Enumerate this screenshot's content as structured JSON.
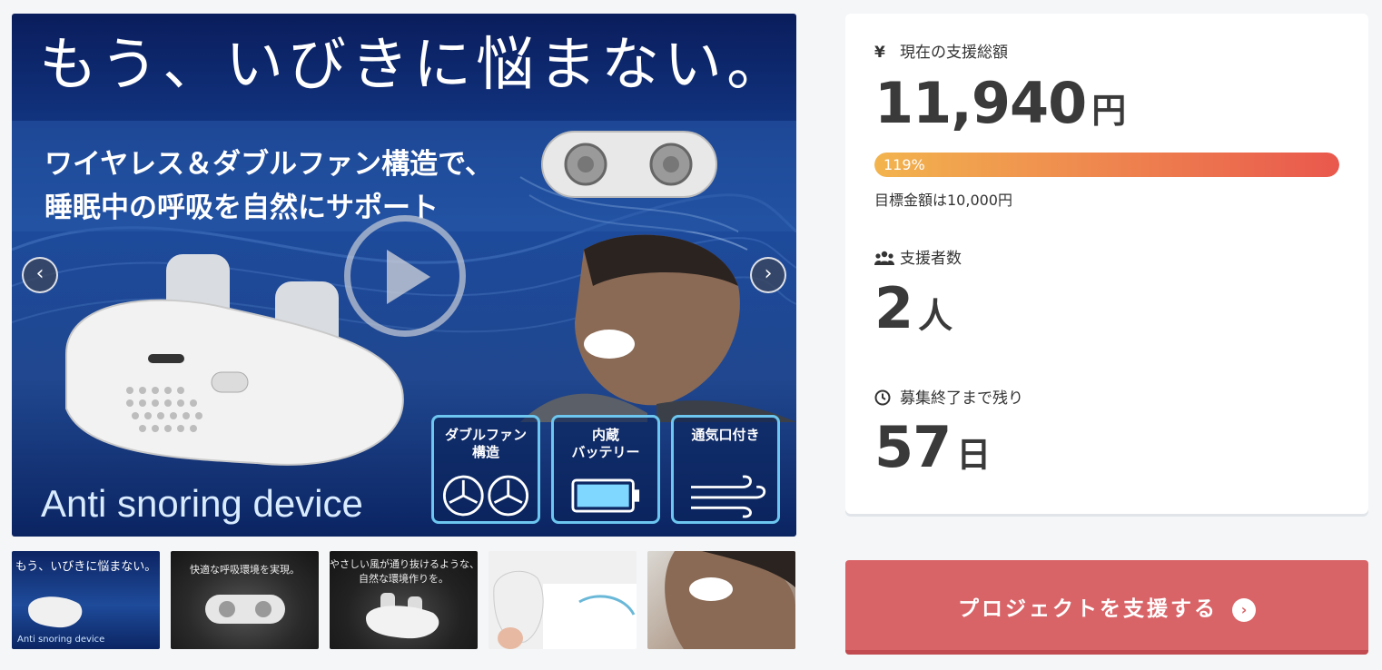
{
  "hero": {
    "headline": "もう、いびきに悩まない。",
    "subline_1": "ワイヤレス＆ダブルファン構造で、",
    "subline_2": "睡眠中の呼吸を自然にサポート",
    "bottom_text": "Anti snoring device",
    "features": [
      {
        "label": "ダブルファン\n構造",
        "icon": "fan-icon"
      },
      {
        "label": "内蔵\nバッテリー",
        "icon": "battery-icon"
      },
      {
        "label": "通気口付き",
        "icon": "wind-icon"
      }
    ],
    "prev_icon": "‹",
    "next_icon": "›"
  },
  "thumbnails": [
    {
      "caption": "もう、いびきに悩まない。",
      "caption2": "Anti snoring device"
    },
    {
      "caption": "快適な呼吸環境を実現。"
    },
    {
      "caption": "やさしい風が通り抜けるような、",
      "caption2": "自然な環境作りを。"
    },
    {
      "caption": ""
    },
    {
      "caption": ""
    }
  ],
  "stats": {
    "total": {
      "icon": "¥",
      "label": "現在の支援総額",
      "value": "11,940",
      "unit": "円"
    },
    "progress": {
      "percent_label": "119%",
      "percent": 119
    },
    "goal_text": "目標金額は10,000円",
    "supporters": {
      "icon": "users-icon",
      "label": "支援者数",
      "value": "2",
      "unit": "人"
    },
    "remaining": {
      "icon": "clock-icon",
      "label": "募集終了まで残り",
      "value": "57",
      "unit": "日"
    }
  },
  "cta": {
    "label": "プロジェクトを支援する",
    "icon": "›"
  },
  "colors": {
    "cta": "#d96468",
    "progress_start": "#f2b44e",
    "progress_end": "#e9584d",
    "feature_border": "#6cc6ef"
  }
}
